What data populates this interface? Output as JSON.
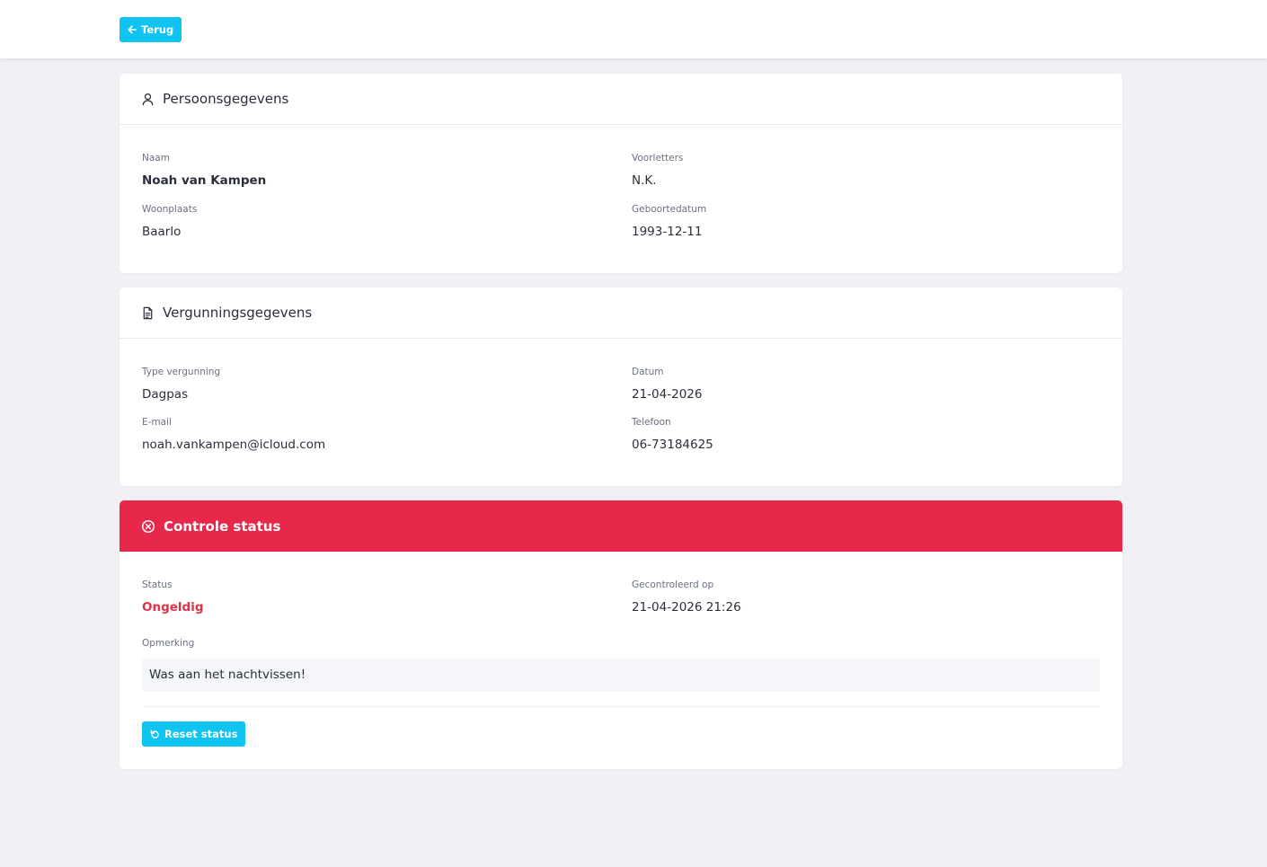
{
  "nav": {
    "back_label": "Terug"
  },
  "person": {
    "title": "Persoonsgegevens",
    "icon": "user-icon",
    "fields": {
      "name_label": "Naam",
      "name": "Noah van Kampen",
      "initials_label": "Voorletters",
      "initials": "N.K.",
      "city_label": "Woonplaats",
      "city": "Baarlo",
      "birthdate_label": "Geboortedatum",
      "birthdate": "1993-12-11"
    }
  },
  "license": {
    "title": "Vergunningsgegevens",
    "icon": "document-icon",
    "fields": {
      "type_label": "Type vergunning",
      "type": "Dagpas",
      "date_label": "Datum",
      "date": "21-04-2026",
      "email_label": "E-mail",
      "email": "noah.vankampen@icloud.com",
      "phone_label": "Telefoon",
      "phone": "06-73184625"
    }
  },
  "check": {
    "title": "Controle status",
    "icon": "x-circle-icon",
    "header_color": "#e8284a",
    "status_label": "Status",
    "status": "Ongeldig",
    "status_color": "#e0324a",
    "checked_label": "Gecontroleerd op",
    "checked_at": "21-04-2026 21:26",
    "remark_label": "Opmerking",
    "remark": "Was aan het nachtvissen!",
    "reset_label": "Reset status"
  },
  "colors": {
    "accent": "#10c4f2",
    "background": "#f0f0f5"
  }
}
